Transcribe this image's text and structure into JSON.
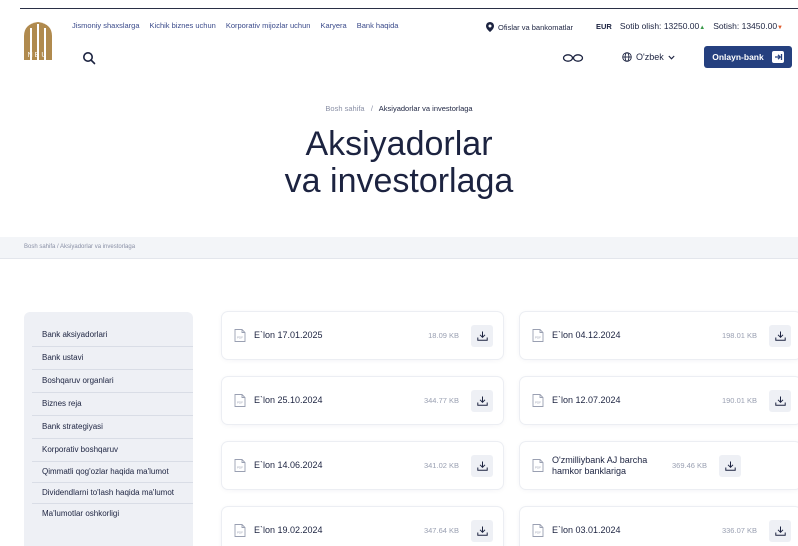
{
  "header": {
    "logo_text": "NBU",
    "nav": [
      "Jismoniy shaxslarga",
      "Kichik biznes uchun",
      "Korporativ mijozlar uchun",
      "Karyera",
      "Bank haqida"
    ],
    "offices": "Ofislar va bankomatlar",
    "currency": "EUR",
    "buy_label": "Sotib olish:",
    "buy_value": "13250.00",
    "sell_label": "Sotish:",
    "sell_value": "13450.00",
    "language": "O'zbek",
    "online_bank": "Onlayn-bank"
  },
  "breadcrumb": {
    "home": "Bosh sahifa",
    "separator": "/",
    "current": "Aksiyadorlar va investorlaga"
  },
  "page_title_line1": "Aksiyadorlar",
  "page_title_line2": "va investorlaga",
  "breadcrumb_band": "Bosh sahifa  /  Aksiyadorlar va investorlaga",
  "sidebar": [
    "Bank aksiyadorlari",
    "Bank ustavi",
    "Boshqaruv organlari",
    "Biznes reja",
    "Bank strategiyasi",
    "Korporativ boshqaruv",
    "Qimmatli qog'ozlar haqida ma'lumot",
    "Dividendlarni to'lash haqida ma'lumot",
    "Ma'lumotlar oshkorligi"
  ],
  "documents": [
    {
      "title": "E`lon 17.01.2025",
      "size": "18.09 KB"
    },
    {
      "title": "E`lon 04.12.2024",
      "size": "198.01 KB"
    },
    {
      "title": "E`lon 25.10.2024",
      "size": "344.77 KB"
    },
    {
      "title": "E`lon 12.07.2024",
      "size": "190.01 KB"
    },
    {
      "title": "E`lon 14.06.2024",
      "size": "341.02 KB"
    },
    {
      "title": "O'zmilliybank AJ barcha hamkor banklariga",
      "size": "369.46 KB"
    },
    {
      "title": "E`lon 19.02.2024",
      "size": "347.64 KB"
    },
    {
      "title": "E`lon 03.01.2024",
      "size": "336.07 KB"
    }
  ],
  "colors": {
    "primary": "#25407f",
    "text": "#1c2340",
    "up": "#3a9a4a",
    "down": "#e05a2a",
    "logo": "#b08a4e"
  }
}
